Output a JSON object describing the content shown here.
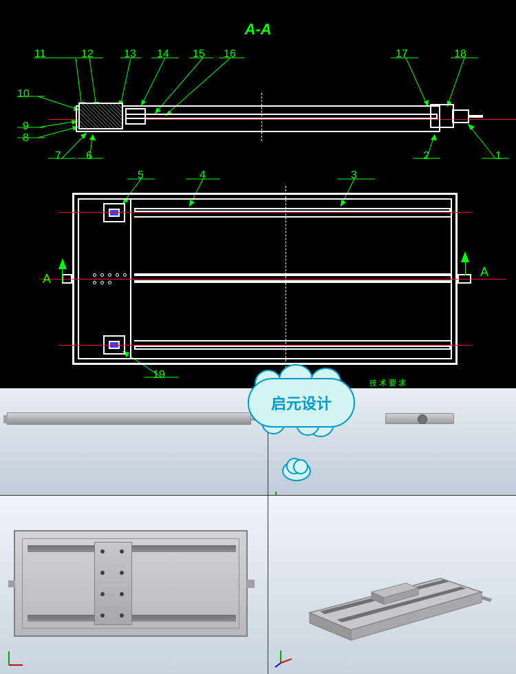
{
  "title": "A-A",
  "callouts": {
    "n1": "1",
    "n2": "2",
    "n3": "3",
    "n4": "4",
    "n5": "5",
    "n6": "6",
    "n7": "7",
    "n8": "8",
    "n9": "9",
    "n10": "10",
    "n11": "11",
    "n12": "12",
    "n13": "13",
    "n14": "14",
    "n15": "15",
    "n16": "16",
    "n17": "17",
    "n18": "18",
    "n19": "19"
  },
  "section_label_left": "A",
  "section_label_right": "A",
  "tech_req": "技 术 要 求",
  "watermark": "启元设计",
  "colors": {
    "cad_bg": "#000000",
    "cad_lines": "#ffffff",
    "callout_green": "#00ff00",
    "axis_red": "#ff0000",
    "bearing_blue": "#4040ff",
    "cloud_fill": "#d4f4f4",
    "cloud_stroke": "#0099cc"
  }
}
